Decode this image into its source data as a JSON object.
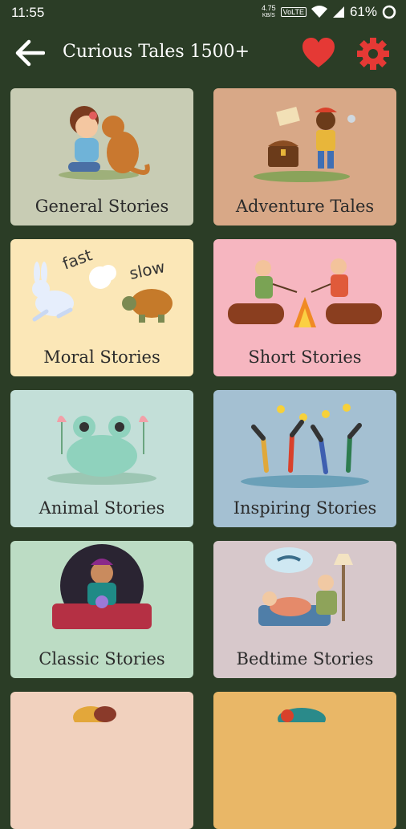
{
  "status": {
    "time": "11:55",
    "net_speed": "4.75",
    "net_unit": "KB/S",
    "volte": "VoLTE",
    "battery": "61%"
  },
  "appbar": {
    "title": "Curious Tales 1500+"
  },
  "colors": {
    "background": "#2b3d26",
    "heart": "#e53935",
    "gear": "#e53935"
  },
  "categories": [
    {
      "label": "General Stories",
      "bg": "#c8ccb4"
    },
    {
      "label": "Adventure Tales",
      "bg": "#d8a887"
    },
    {
      "label": "Moral Stories",
      "bg": "#fbe7b7"
    },
    {
      "label": "Short Stories",
      "bg": "#f6b6c0"
    },
    {
      "label": "Animal Stories",
      "bg": "#c3dfd8"
    },
    {
      "label": "Inspiring Stories",
      "bg": "#a4c0d2"
    },
    {
      "label": "Classic Stories",
      "bg": "#bcdcc4"
    },
    {
      "label": "Bedtime Stories",
      "bg": "#d7c8cb"
    },
    {
      "label": "",
      "bg": "#f1d1be"
    },
    {
      "label": "",
      "bg": "#e9b767"
    }
  ],
  "art_text": {
    "fast": "fast",
    "slow": "slow"
  }
}
